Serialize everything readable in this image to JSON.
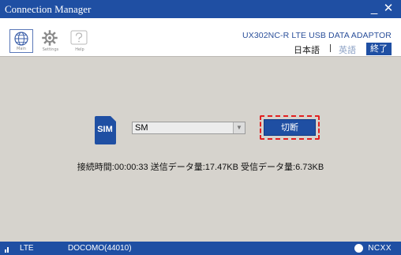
{
  "window": {
    "title": "Connection Manager",
    "minimize": "_",
    "close": "✕"
  },
  "toolbar": {
    "tools": [
      {
        "name": "main",
        "label": "Main",
        "icon": "globe-icon"
      },
      {
        "name": "settings",
        "label": "Settings",
        "icon": "gear-icon"
      },
      {
        "name": "help",
        "label": "Help",
        "icon": "question-icon"
      }
    ]
  },
  "header": {
    "product": "UX302NC-R LTE USB DATA ADAPTOR",
    "lang_japanese": "日本語",
    "lang_english": "英語",
    "exit_label": "終了"
  },
  "main": {
    "sim_label": "SIM",
    "selected_sim": "SM",
    "disconnect_label": "切断",
    "stats": "接続時間:00:00:33  送信データ量:17.47KB  受信データ量:6.73KB"
  },
  "status": {
    "network": "LTE",
    "carrier": "DOCOMO(44010)",
    "brand": "NCXX"
  },
  "colors": {
    "titlebar": "#1f4fa3",
    "accent": "#1f4fa3",
    "body": "#d6d3cd",
    "focus": "#e32020"
  }
}
